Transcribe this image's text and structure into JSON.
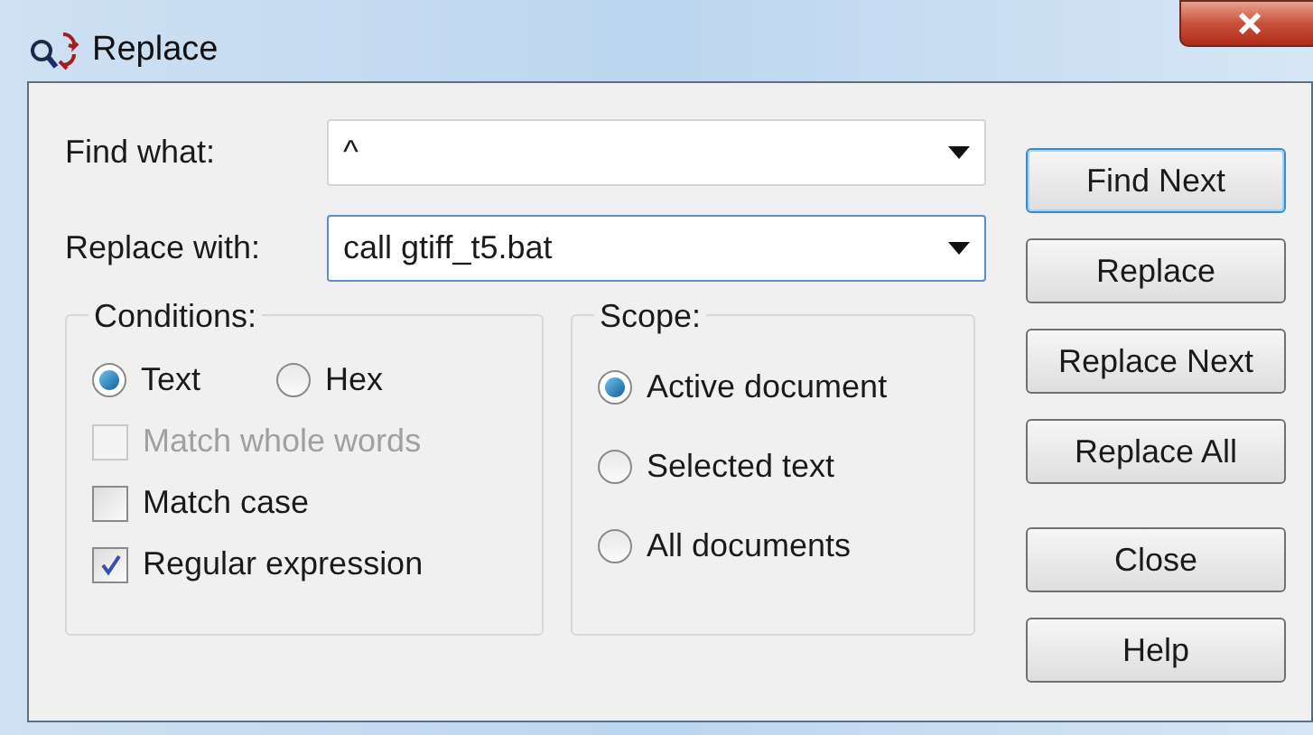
{
  "window": {
    "title": "Replace"
  },
  "fields": [
    {
      "label": "Find what:",
      "value": "^",
      "focused": false
    },
    {
      "label": "Replace with:",
      "value": "call gtiff_t5.bat",
      "focused": true
    }
  ],
  "conditions": {
    "title": "Conditions:",
    "radios": [
      {
        "label": "Text",
        "selected": true
      },
      {
        "label": "Hex",
        "selected": false
      }
    ],
    "checkboxes": [
      {
        "label": "Match whole words",
        "checked": false,
        "disabled": true
      },
      {
        "label": "Match case",
        "checked": false,
        "disabled": false
      },
      {
        "label": "Regular expression",
        "checked": true,
        "disabled": false
      }
    ]
  },
  "scope": {
    "title": "Scope:",
    "radios": [
      {
        "label": "Active document",
        "selected": true
      },
      {
        "label": "Selected text",
        "selected": false
      },
      {
        "label": "All documents",
        "selected": false
      }
    ]
  },
  "buttons": [
    {
      "label": "Find Next",
      "default": true
    },
    {
      "label": "Replace",
      "default": false
    },
    {
      "label": "Replace Next",
      "default": false
    },
    {
      "label": "Replace All",
      "default": false
    },
    {
      "label": "Close",
      "default": false
    },
    {
      "label": "Help",
      "default": false
    }
  ]
}
